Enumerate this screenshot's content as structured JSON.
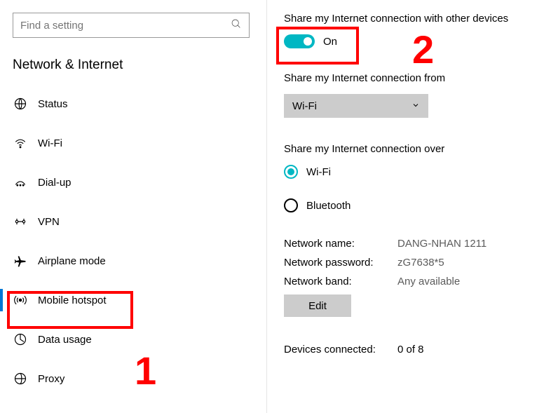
{
  "search": {
    "placeholder": "Find a setting"
  },
  "section_title": "Network & Internet",
  "nav": [
    {
      "label": "Status",
      "icon": "globe"
    },
    {
      "label": "Wi-Fi",
      "icon": "wifi"
    },
    {
      "label": "Dial-up",
      "icon": "dialup"
    },
    {
      "label": "VPN",
      "icon": "vpn"
    },
    {
      "label": "Airplane mode",
      "icon": "airplane"
    },
    {
      "label": "Mobile hotspot",
      "icon": "hotspot",
      "selected": true
    },
    {
      "label": "Data usage",
      "icon": "datausage"
    },
    {
      "label": "Proxy",
      "icon": "proxy"
    }
  ],
  "main": {
    "share_label": "Share my Internet connection with other devices",
    "toggle_state": "On",
    "share_from_label": "Share my Internet connection from",
    "share_from_value": "Wi-Fi",
    "share_over_label": "Share my Internet connection over",
    "radios": [
      {
        "label": "Wi-Fi",
        "checked": true
      },
      {
        "label": "Bluetooth",
        "checked": false
      }
    ],
    "info": {
      "name_key": "Network name:",
      "name_val": "DANG-NHAN 1211",
      "pwd_key": "Network password:",
      "pwd_val": "zG7638*5",
      "band_key": "Network band:",
      "band_val": "Any available"
    },
    "edit_label": "Edit",
    "devices_key": "Devices connected:",
    "devices_val": "0 of 8"
  },
  "annotations": {
    "n1": "1",
    "n2": "2"
  }
}
